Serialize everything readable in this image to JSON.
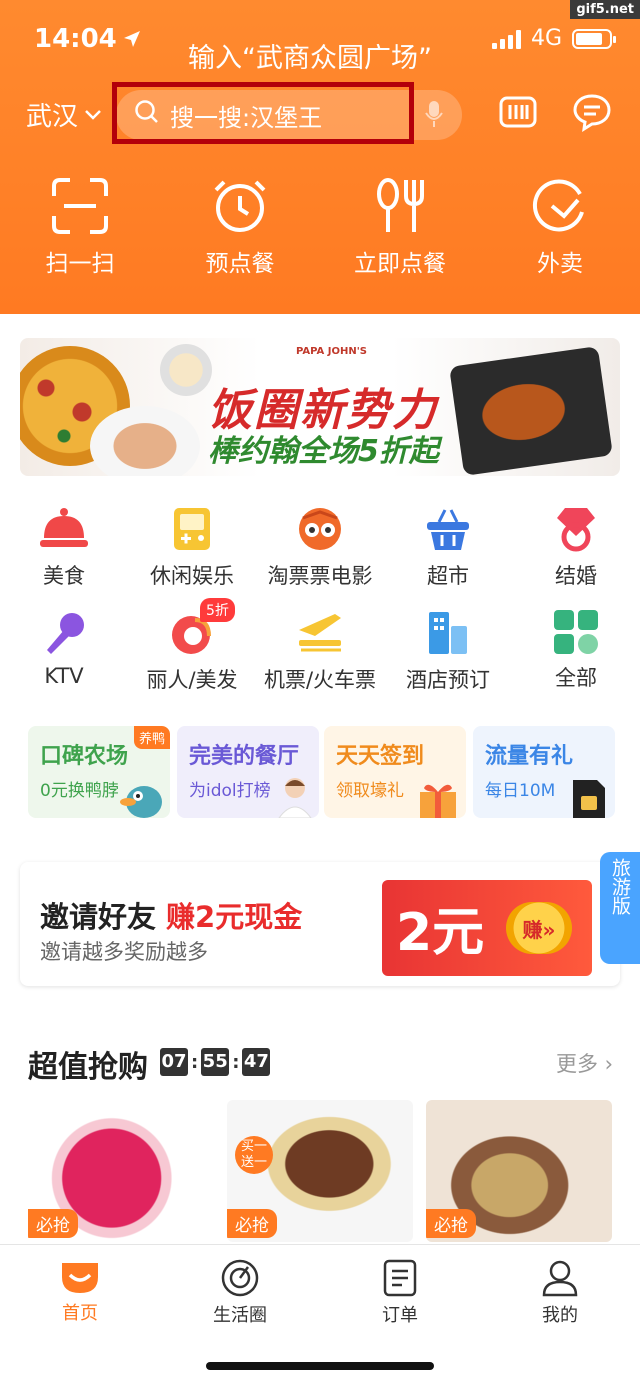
{
  "status": {
    "time": "14:04",
    "network": "4G",
    "watermark": "gif5.net"
  },
  "caption": "输入“武商众圆广场”",
  "header": {
    "city": "武汉",
    "search_placeholder": "搜一搜:汉堡王",
    "quick_actions": [
      {
        "label": "扫一扫",
        "icon": "scan-icon"
      },
      {
        "label": "预点餐",
        "icon": "alarm-clock-icon"
      },
      {
        "label": "立即点餐",
        "icon": "utensils-icon"
      },
      {
        "label": "外卖",
        "icon": "delivery-icon"
      }
    ]
  },
  "banner": {
    "title": "饭圈新势力",
    "subtitle": "棒约翰全场5折起",
    "brand": "PAPA JOHN'S"
  },
  "categories": [
    {
      "label": "美食",
      "icon": "food-cloche-icon"
    },
    {
      "label": "休闲娱乐",
      "icon": "gameboy-icon"
    },
    {
      "label": "淘票票电影",
      "icon": "movie-mascot-icon"
    },
    {
      "label": "超市",
      "icon": "basket-icon"
    },
    {
      "label": "结婚",
      "icon": "diamond-ring-icon"
    },
    {
      "label": "KTV",
      "icon": "microphone-icon"
    },
    {
      "label": "丽人/美发",
      "icon": "beauty-icon",
      "badge": "5折"
    },
    {
      "label": "机票/火车票",
      "icon": "plane-train-icon"
    },
    {
      "label": "酒店预订",
      "icon": "hotel-icon"
    },
    {
      "label": "全部",
      "icon": "grid-icon"
    }
  ],
  "promos": [
    {
      "title": "口碑农场",
      "sub": "0元换鸭脖",
      "tag": "养鸭",
      "color": "#3fa34d"
    },
    {
      "title": "完美的餐厅",
      "sub": "为idol打榜",
      "color": "#6a59d6"
    },
    {
      "title": "天天签到",
      "sub": "领取壕礼",
      "color": "#f08b1d"
    },
    {
      "title": "流量有礼",
      "sub": "每日10M",
      "color": "#3b86e6"
    }
  ],
  "invite": {
    "title": "邀请好友",
    "highlight": "赚2元现金",
    "sub": "邀请越多奖励越多",
    "amount": "2元",
    "earn": "赚»"
  },
  "travel_tab": "旅游版",
  "deals": {
    "title": "超值抢购",
    "timer": [
      "07",
      "55",
      "47"
    ],
    "more": "更多 ›",
    "items": [
      {
        "tag": "必抢"
      },
      {
        "tag": "必抢",
        "corner": "买一送一"
      },
      {
        "tag": "必抢"
      }
    ]
  },
  "tabbar": [
    {
      "label": "首页",
      "icon": "home-icon",
      "active": true
    },
    {
      "label": "生活圈",
      "icon": "life-circle-icon"
    },
    {
      "label": "订单",
      "icon": "order-icon"
    },
    {
      "label": "我的",
      "icon": "profile-icon"
    }
  ],
  "colors": {
    "primary": "#ff7a22",
    "highlight_box": "#b3000a",
    "price_red": "#e92c2c"
  }
}
